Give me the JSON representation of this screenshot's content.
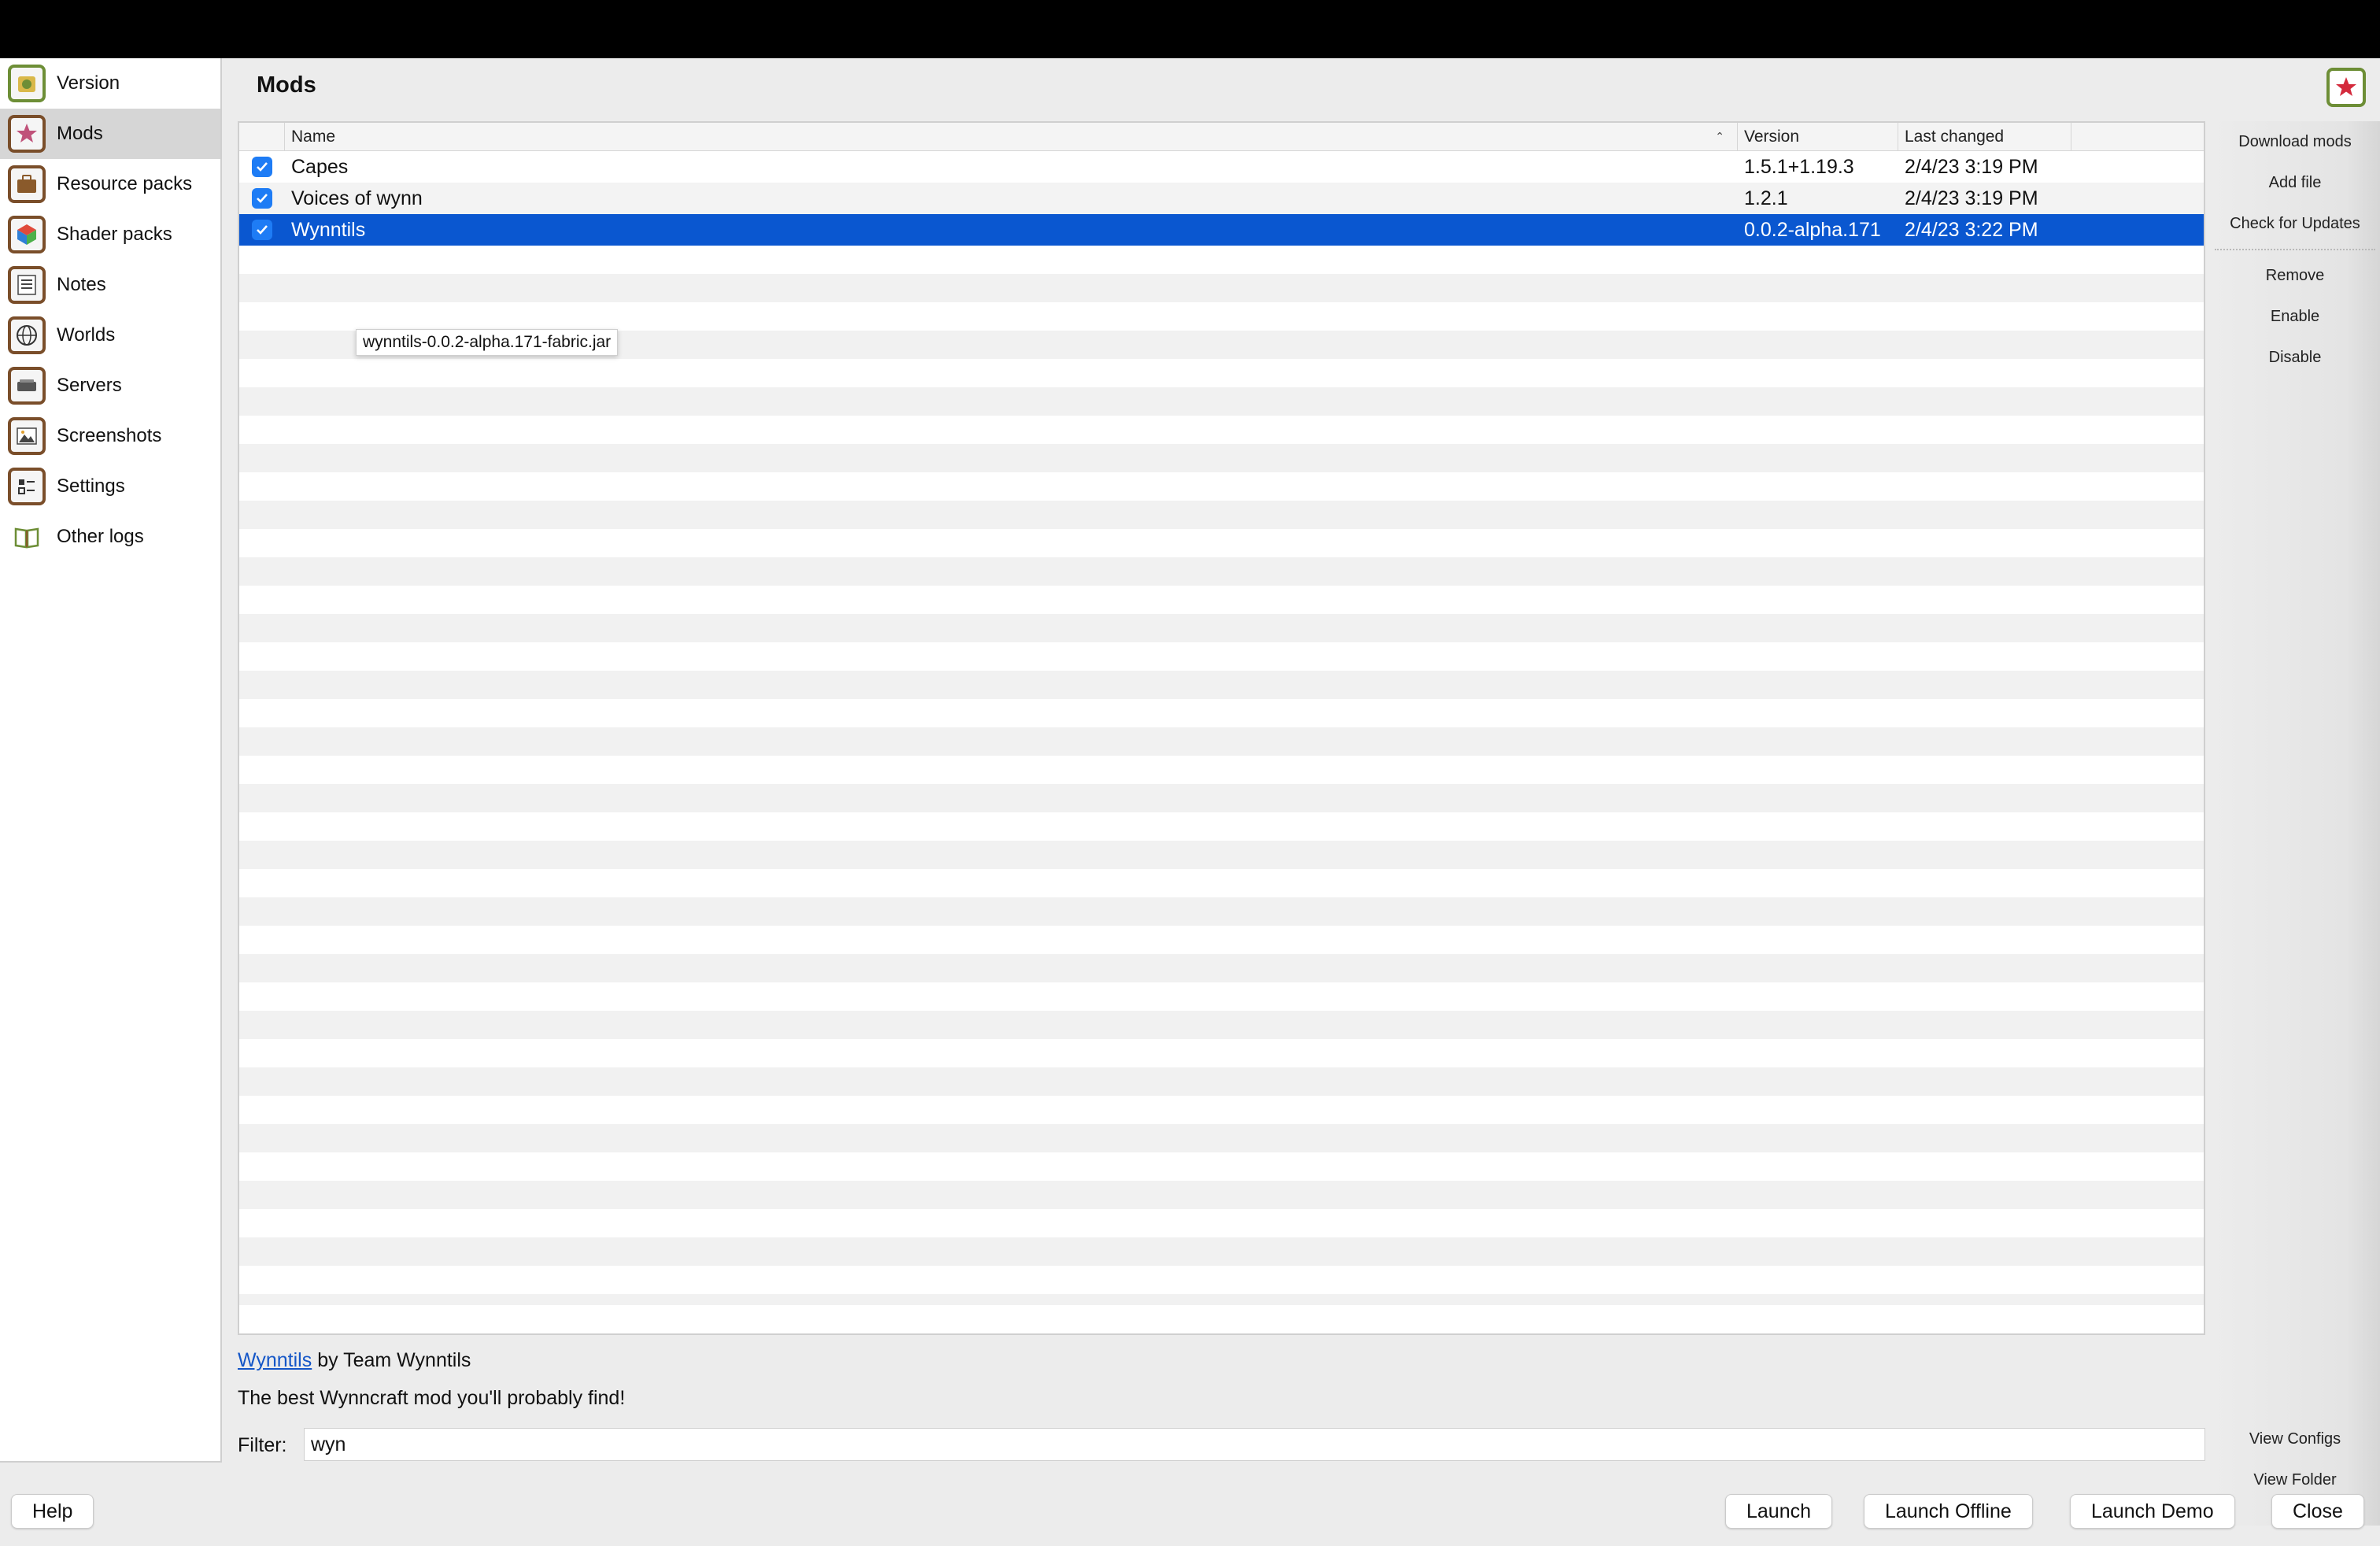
{
  "sidebar": {
    "items": [
      {
        "label": "Version",
        "icon": "version-icon"
      },
      {
        "label": "Mods",
        "icon": "mods-star-icon"
      },
      {
        "label": "Resource packs",
        "icon": "resource-packs-icon"
      },
      {
        "label": "Shader packs",
        "icon": "shader-packs-icon"
      },
      {
        "label": "Notes",
        "icon": "notes-icon"
      },
      {
        "label": "Worlds",
        "icon": "worlds-icon"
      },
      {
        "label": "Servers",
        "icon": "servers-icon"
      },
      {
        "label": "Screenshots",
        "icon": "screenshots-icon"
      },
      {
        "label": "Settings",
        "icon": "settings-icon"
      },
      {
        "label": "Other logs",
        "icon": "other-logs-icon"
      }
    ],
    "active": "Mods"
  },
  "page": {
    "title": "Mods"
  },
  "table": {
    "columns": [
      "Name",
      "Version",
      "Last changed"
    ],
    "sort_column": "Name",
    "rows": [
      {
        "name": "Capes",
        "version": "1.5.1+1.19.3",
        "changed": "2/4/23 3:19 PM",
        "enabled": true
      },
      {
        "name": "Voices of wynn",
        "version": "1.2.1",
        "changed": "2/4/23 3:19 PM",
        "enabled": true
      },
      {
        "name": "Wynntils",
        "version": "0.0.2-alpha.171",
        "changed": "2/4/23 3:22 PM",
        "enabled": true,
        "selected": true
      }
    ]
  },
  "tooltip": "wynntils-0.0.2-alpha.171-fabric.jar",
  "actions": {
    "download_mods": "Download mods",
    "add_file": "Add file",
    "check_updates": "Check for Updates",
    "remove": "Remove",
    "enable": "Enable",
    "disable": "Disable",
    "view_configs": "View Configs",
    "view_folder": "View Folder"
  },
  "details": {
    "mod_link": "Wynntils",
    "author_text": " by Team Wynntils",
    "description": "The best Wynncraft mod you'll probably find!"
  },
  "filter": {
    "label": "Filter:",
    "value": "wyn"
  },
  "footer": {
    "help": "Help",
    "launch": "Launch",
    "launch_offline": "Launch Offline",
    "launch_demo": "Launch Demo",
    "close": "Close"
  },
  "colors": {
    "selection": "#0a57d0",
    "checkbox": "#1e7cf5",
    "link": "#1456c7"
  }
}
